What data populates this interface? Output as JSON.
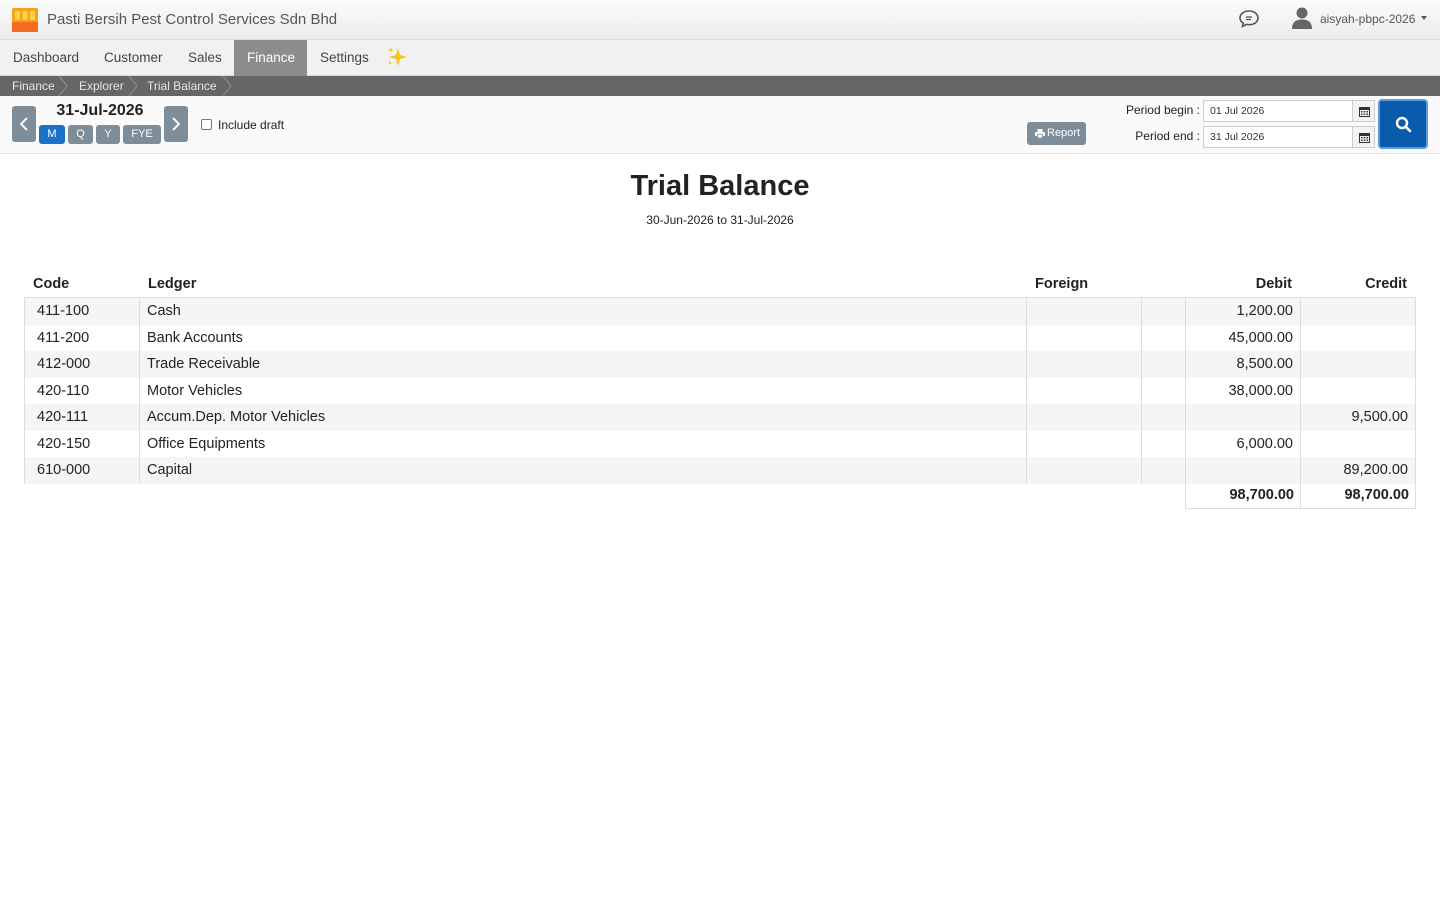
{
  "app": {
    "company_name": "Pasti Bersih Pest Control Services Sdn Bhd",
    "user_name": "aisyah-pbpc-2026",
    "logo_colors": [
      "#f7a21b",
      "#f26d21",
      "#ffd24a"
    ]
  },
  "nav": {
    "items": [
      {
        "label": "Dashboard",
        "active": false
      },
      {
        "label": "Customer",
        "active": false
      },
      {
        "label": "Sales",
        "active": false
      },
      {
        "label": "Finance",
        "active": true
      },
      {
        "label": "Settings",
        "active": false
      }
    ],
    "sparkle_icon": "sparkles-icon"
  },
  "breadcrumb": [
    "Finance",
    "Explorer",
    "Trial Balance"
  ],
  "toolbar": {
    "current_date": "31-Jul-2026",
    "period_buttons": [
      {
        "label": "M",
        "active": true
      },
      {
        "label": "Q",
        "active": false
      },
      {
        "label": "Y",
        "active": false
      },
      {
        "label": "FYE",
        "active": false
      }
    ],
    "include_draft_label": "Include draft",
    "include_draft_checked": false,
    "report_label": "Report",
    "period_begin_label": "Period begin :",
    "period_begin_value": "01 Jul 2026",
    "period_end_label": "Period end :",
    "period_end_value": "31 Jul 2026"
  },
  "report": {
    "title": "Trial Balance",
    "subtitle": "30-Jun-2026 to 31-Jul-2026",
    "columns": {
      "code": "Code",
      "ledger": "Ledger",
      "foreign": "Foreign",
      "debit": "Debit",
      "credit": "Credit"
    },
    "rows": [
      {
        "code": "411-100",
        "ledger": "Cash",
        "debit": "1,200.00",
        "credit": ""
      },
      {
        "code": "411-200",
        "ledger": "Bank Accounts",
        "debit": "45,000.00",
        "credit": ""
      },
      {
        "code": "412-000",
        "ledger": "Trade Receivable",
        "debit": "8,500.00",
        "credit": ""
      },
      {
        "code": "420-110",
        "ledger": "Motor Vehicles",
        "debit": "38,000.00",
        "credit": ""
      },
      {
        "code": "420-111",
        "ledger": "Accum.Dep. Motor Vehicles",
        "debit": "",
        "credit": "9,500.00"
      },
      {
        "code": "420-150",
        "ledger": "Office Equipments",
        "debit": "6,000.00",
        "credit": ""
      },
      {
        "code": "610-000",
        "ledger": "Capital",
        "debit": "",
        "credit": "89,200.00"
      }
    ],
    "total_debit": "98,700.00",
    "total_credit": "98,700.00"
  }
}
